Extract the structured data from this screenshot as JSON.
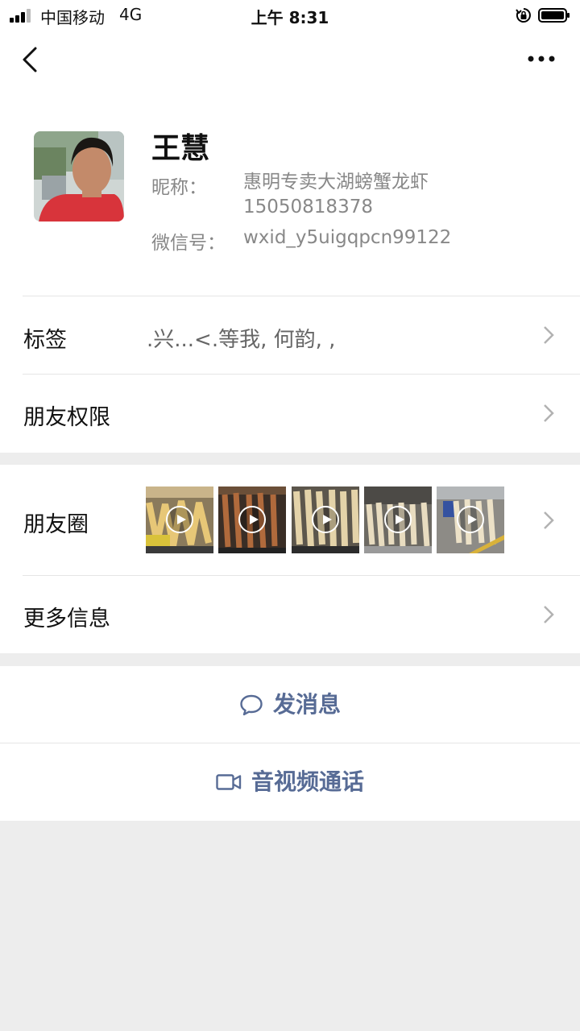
{
  "status_bar": {
    "carrier": "中国移动",
    "network": "4G",
    "time": "上午 8:31"
  },
  "header": {
    "back_icon": "chevron-left-icon",
    "more_icon": "more-dots-icon"
  },
  "profile": {
    "name": "王慧",
    "nickname_label": "昵称：",
    "nickname_line1": "惠明专卖大湖螃蟹龙虾",
    "nickname_line2": "15050818378",
    "wechat_id_label": "微信号：",
    "wechat_id": "wxid_y5uigqpcn99122"
  },
  "rows": {
    "tags": {
      "label": "标签",
      "value": ".兴...<.等我, 何韵, ,"
    },
    "permissions": {
      "label": "朋友权限"
    },
    "moments": {
      "label": "朋友圈",
      "thumbnail_count": 5
    },
    "more_info": {
      "label": "更多信息"
    }
  },
  "actions": {
    "message": {
      "label": "发消息",
      "icon": "chat-bubble-icon"
    },
    "call": {
      "label": "音视频通话",
      "icon": "video-camera-icon"
    }
  },
  "colors": {
    "link": "#576b95",
    "background": "#ededed"
  }
}
